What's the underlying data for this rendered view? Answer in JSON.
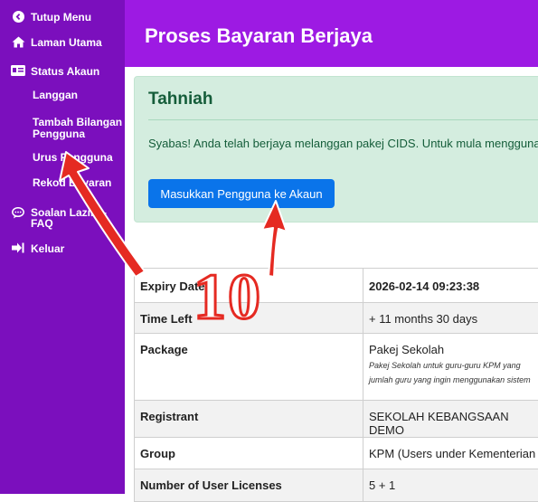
{
  "sidebar": {
    "close_menu": "Tutup Menu",
    "home": "Laman Utama",
    "account_status": "Status Akaun",
    "subitems": [
      {
        "label": "Langgan"
      },
      {
        "label": "Tambah Bilangan Pengguna"
      },
      {
        "label": "Urus Pengguna"
      },
      {
        "label": "Rekod Bayaran"
      }
    ],
    "faq": "Soalan Lazim - FAQ",
    "logout": "Keluar",
    "icons": [
      "chevron-left-circle-icon",
      "home-icon",
      "id-card-icon",
      "chat-icon",
      "logout-icon"
    ]
  },
  "header": {
    "title": "Proses Bayaran Berjaya",
    "color": "#9d1ae3"
  },
  "alert": {
    "title": "Tahniah",
    "message": "Syabas! Anda telah berjaya melanggan pakej CIDS. Untuk mula menggunakan",
    "button_label": "Masukkan Pengguna ke Akaun"
  },
  "table": {
    "rows": [
      {
        "label": "Expiry Date",
        "value": "2026-02-14 09:23:38"
      },
      {
        "label": "Time Left",
        "value": "+ 11 months 30 days"
      },
      {
        "label": "Package",
        "value": "Pakej Sekolah",
        "note1": "Pakej Sekolah untuk guru-guru KPM yang",
        "note2": "jumlah guru yang ingin menggunakan sistem"
      },
      {
        "label": "Registrant",
        "value": "SEKOLAH KEBANGSAAN DEMO"
      },
      {
        "label": "Group",
        "value": "KPM (Users under Kementerian"
      },
      {
        "label": "Number of User Licenses",
        "value": "5 + 1"
      }
    ]
  },
  "annotation": {
    "step_number": "10",
    "arrow_color": "#e52a22"
  }
}
